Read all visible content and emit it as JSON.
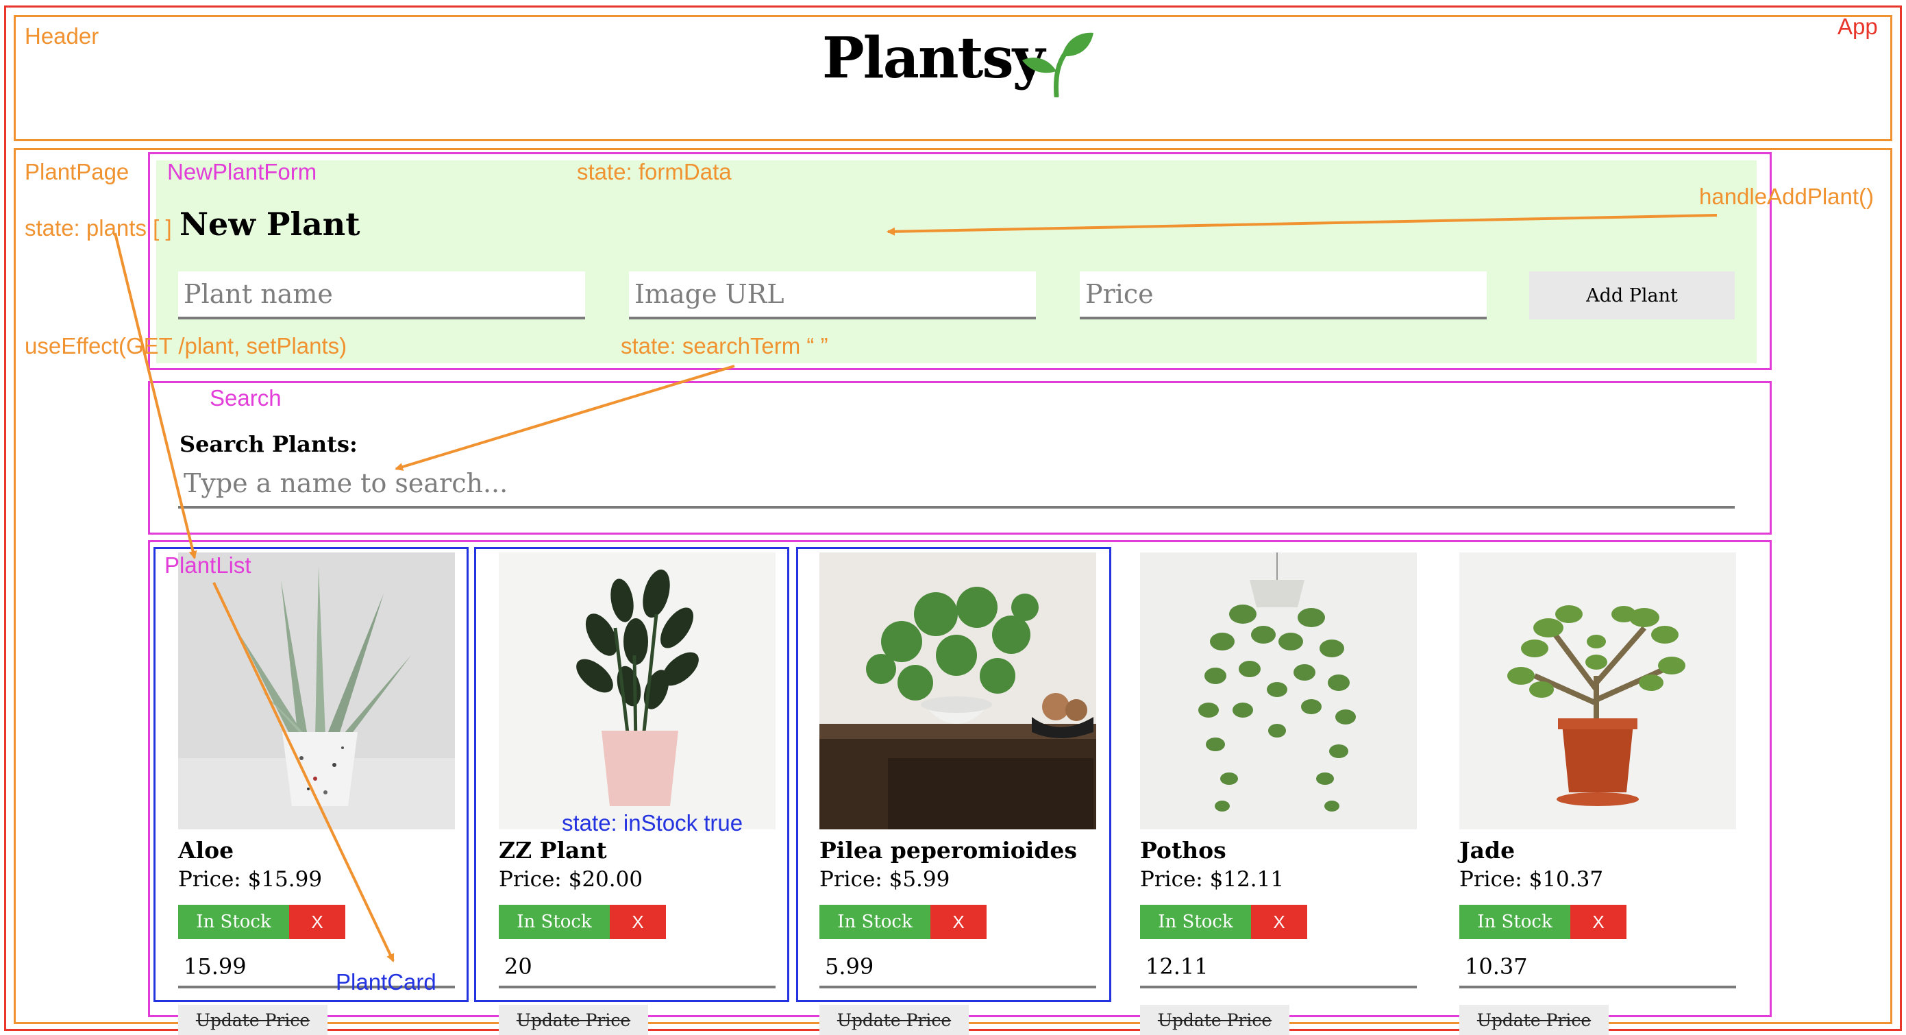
{
  "app": {
    "title": "Plantsy",
    "logo_icon": "sprout-icon"
  },
  "annotations": {
    "header": "Header",
    "app": "App",
    "plant_page": "PlantPage",
    "new_plant_form": "NewPlantForm",
    "form_state": "state: formData",
    "handle_add": "handleAddPlant()",
    "plants_state": "state: plants [ ]",
    "use_effect": "useEffect(GET /plant, setPlants)",
    "search_state": "state: searchTerm “ ”",
    "search": "Search",
    "plant_list": "PlantList",
    "in_stock_state": "state: inStock true",
    "plant_card": "PlantCard"
  },
  "form": {
    "title": "New Plant",
    "name_placeholder": "Plant name",
    "image_placeholder": "Image URL",
    "price_placeholder": "Price",
    "submit_label": "Add Plant"
  },
  "search": {
    "label": "Search Plants:",
    "placeholder": "Type a name to search..."
  },
  "plants": [
    {
      "name": "Aloe",
      "price": "Price: $15.99",
      "stock_label": "In Stock",
      "delete_label": "X",
      "price_value": "15.99",
      "update_label": "Update Price"
    },
    {
      "name": "ZZ Plant",
      "price": "Price: $20.00",
      "stock_label": "In Stock",
      "delete_label": "X",
      "price_value": "20",
      "update_label": "Update Price"
    },
    {
      "name": "Pilea peperomioides",
      "price": "Price: $5.99",
      "stock_label": "In Stock",
      "delete_label": "X",
      "price_value": "5.99",
      "update_label": "Update Price"
    },
    {
      "name": "Pothos",
      "price": "Price: $12.11",
      "stock_label": "In Stock",
      "delete_label": "X",
      "price_value": "12.11",
      "update_label": "Update Price"
    },
    {
      "name": "Jade",
      "price": "Price: $10.37",
      "stock_label": "In Stock",
      "delete_label": "X",
      "price_value": "10.37",
      "update_label": "Update Price"
    }
  ],
  "colors": {
    "app_border": "#e8372a",
    "orange": "#f0922f",
    "pink": "#e23cd9",
    "blue": "#2433e0",
    "form_bg": "#e5fbdc",
    "in_stock": "#4cb049",
    "delete": "#e6312a"
  }
}
